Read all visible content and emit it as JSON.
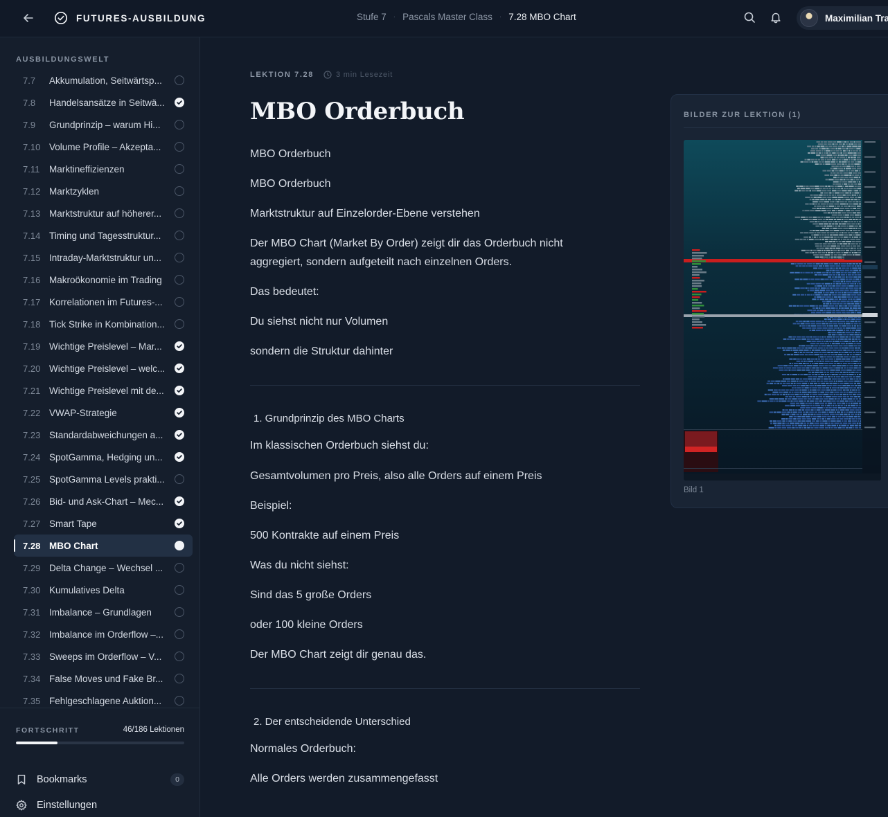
{
  "header": {
    "brand": "FUTURES-AUSBILDUNG",
    "breadcrumb": [
      "Stufe 7",
      "Pascals Master Class",
      "7.28 MBO Chart"
    ],
    "user_name": "Maximilian Tra"
  },
  "sidebar": {
    "heading": "AUSBILDUNGSWELT",
    "lessons": [
      {
        "num": "7.7",
        "title": "Akkumulation, Seitwärtsp...",
        "status": "open"
      },
      {
        "num": "7.8",
        "title": "Handelsansätze in Seitwä...",
        "status": "done"
      },
      {
        "num": "7.9",
        "title": "Grundprinzip – warum Hi...",
        "status": "open"
      },
      {
        "num": "7.10",
        "title": "Volume Profile – Akzepta...",
        "status": "open"
      },
      {
        "num": "7.11",
        "title": "Marktineffizienzen",
        "status": "open"
      },
      {
        "num": "7.12",
        "title": "Marktzyklen",
        "status": "open"
      },
      {
        "num": "7.13",
        "title": "Marktstruktur auf höherer...",
        "status": "open"
      },
      {
        "num": "7.14",
        "title": "Timing und Tagesstruktur...",
        "status": "open"
      },
      {
        "num": "7.15",
        "title": "Intraday-Marktstruktur un...",
        "status": "open"
      },
      {
        "num": "7.16",
        "title": "Makroökonomie im Trading",
        "status": "open"
      },
      {
        "num": "7.17",
        "title": "Korrelationen im Futures-...",
        "status": "open"
      },
      {
        "num": "7.18",
        "title": "Tick Strike in Kombination...",
        "status": "open"
      },
      {
        "num": "7.19",
        "title": "Wichtige Preislevel – Mar...",
        "status": "done"
      },
      {
        "num": "7.20",
        "title": "Wichtige Preislevel – welc...",
        "status": "done"
      },
      {
        "num": "7.21",
        "title": "Wichtige Preislevel mit de...",
        "status": "done"
      },
      {
        "num": "7.22",
        "title": "VWAP-Strategie",
        "status": "done"
      },
      {
        "num": "7.23",
        "title": "Standardabweichungen a...",
        "status": "done"
      },
      {
        "num": "7.24",
        "title": "SpotGamma, Hedging un...",
        "status": "done"
      },
      {
        "num": "7.25",
        "title": "SpotGamma Levels prakti...",
        "status": "open"
      },
      {
        "num": "7.26",
        "title": "Bid- und Ask-Chart – Mec...",
        "status": "done"
      },
      {
        "num": "7.27",
        "title": "Smart Tape",
        "status": "done"
      },
      {
        "num": "7.28",
        "title": "MBO Chart",
        "status": "current"
      },
      {
        "num": "7.29",
        "title": "Delta Change – Wechsel ...",
        "status": "open"
      },
      {
        "num": "7.30",
        "title": "Kumulatives Delta",
        "status": "open"
      },
      {
        "num": "7.31",
        "title": "Imbalance – Grundlagen",
        "status": "open"
      },
      {
        "num": "7.32",
        "title": "Imbalance im Orderflow –...",
        "status": "open"
      },
      {
        "num": "7.33",
        "title": "Sweeps im Orderflow – V...",
        "status": "open"
      },
      {
        "num": "7.34",
        "title": "False Moves und Fake Br...",
        "status": "open"
      },
      {
        "num": "7.35",
        "title": "Fehlgeschlagene Auktion...",
        "status": "open"
      }
    ],
    "progress_label": "FORTSCHRITT",
    "progress_count": "46/186 Lektionen",
    "progress_fraction": 0.247,
    "bookmarks_label": "Bookmarks",
    "bookmarks_count": "0",
    "settings_label": "Einstellungen"
  },
  "lesson": {
    "tag": "LEKTION 7.28",
    "read_time": "3 min Lesezeit",
    "title": "MBO Orderbuch",
    "intro": [
      "MBO Orderbuch",
      "MBO Orderbuch",
      "Marktstruktur auf Einzelorder-Ebene verstehen",
      "Der MBO Chart (Market By Order) zeigt dir das Orderbuch nicht aggregiert, sondern aufgeteilt nach einzelnen Orders.",
      "Das bedeutet:",
      "Du siehst nicht nur Volumen",
      "sondern die Struktur dahinter"
    ],
    "section1_heading": "1. Grundprinzip des MBO Charts",
    "section1": [
      "Im klassischen Orderbuch siehst du:",
      "Gesamtvolumen pro Preis, also alle Orders auf einem Preis",
      "Beispiel:",
      "500 Kontrakte auf einem Preis",
      "Was du nicht siehst:",
      "Sind das 5 große Orders",
      "oder 100 kleine Orders",
      "Der MBO Chart zeigt dir genau das."
    ],
    "section2_heading": "2. Der entscheidende Unterschied",
    "section2": [
      "Normales Orderbuch:",
      "Alle Orders werden zusammengefasst"
    ]
  },
  "images_panel": {
    "title": "BILDER ZUR LEKTION (1)",
    "caption": "Bild 1"
  },
  "colors": {
    "background": "#121b29",
    "sidebar": "#151e2c",
    "accent_white": "#f2f4f7",
    "active_item": "#223044"
  }
}
